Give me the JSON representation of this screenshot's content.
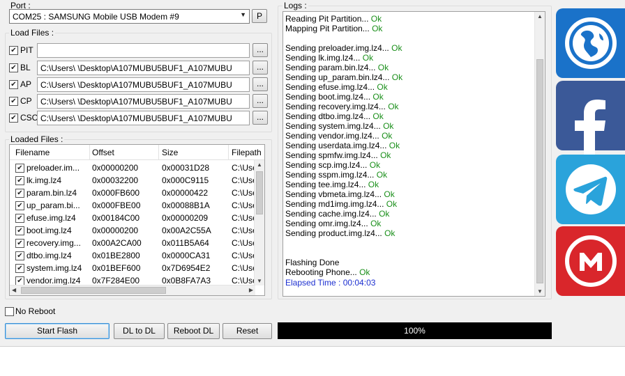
{
  "port": {
    "label": "Port :",
    "selected": "COM25 : SAMSUNG Mobile USB Modem #9",
    "p_button": "P"
  },
  "load_files": {
    "label": "Load Files :",
    "rows": [
      {
        "label": "PIT",
        "checked": true,
        "path": "",
        "browse": "..."
      },
      {
        "label": "BL",
        "checked": true,
        "path": "C:\\Users\\            \\Desktop\\A107MUBU5BUF1_A107MUBU",
        "browse": "..."
      },
      {
        "label": "AP",
        "checked": true,
        "path": "C:\\Users\\            \\Desktop\\A107MUBU5BUF1_A107MUBU",
        "browse": "..."
      },
      {
        "label": "CP",
        "checked": true,
        "path": "C:\\Users\\            \\Desktop\\A107MUBU5BUF1_A107MUBU",
        "browse": "..."
      },
      {
        "label": "CSC",
        "checked": true,
        "path": "C:\\Users\\            \\Desktop\\A107MUBU5BUF1_A107MUBU",
        "browse": "..."
      }
    ]
  },
  "loaded_files": {
    "label": "Loaded Files :",
    "columns": [
      "Filename",
      "Offset",
      "Size",
      "Filepath"
    ],
    "rows": [
      {
        "name": "preloader.im...",
        "offset": "0x00000200",
        "size": "0x00031D28",
        "path": "C:\\Use"
      },
      {
        "name": "lk.img.lz4",
        "offset": "0x00032200",
        "size": "0x000C9115",
        "path": "C:\\Use"
      },
      {
        "name": "param.bin.lz4",
        "offset": "0x000FB600",
        "size": "0x00000422",
        "path": "C:\\Use"
      },
      {
        "name": "up_param.bi...",
        "offset": "0x000FBE00",
        "size": "0x00088B1A",
        "path": "C:\\Use"
      },
      {
        "name": "efuse.img.lz4",
        "offset": "0x00184C00",
        "size": "0x00000209",
        "path": "C:\\Use"
      },
      {
        "name": "boot.img.lz4",
        "offset": "0x00000200",
        "size": "0x00A2C55A",
        "path": "C:\\Use"
      },
      {
        "name": "recovery.img...",
        "offset": "0x00A2CA00",
        "size": "0x011B5A64",
        "path": "C:\\Use"
      },
      {
        "name": "dtbo.img.lz4",
        "offset": "0x01BE2800",
        "size": "0x0000CA31",
        "path": "C:\\Use"
      },
      {
        "name": "system.img.lz4",
        "offset": "0x01BEF600",
        "size": "0x7D6954E2",
        "path": "C:\\Use"
      },
      {
        "name": "vendor.img.lz4",
        "offset": "0x7F284E00",
        "size": "0x0B8FA7A3",
        "path": "C:\\Use"
      }
    ]
  },
  "logs": {
    "label": "Logs :",
    "lines": [
      {
        "text": "Reading Pit Partition...",
        "ok": "Ok"
      },
      {
        "text": "Mapping Pit Partition...",
        "ok": "Ok"
      },
      {
        "text": "",
        "ok": ""
      },
      {
        "text": "Sending preloader.img.lz4...",
        "ok": "Ok"
      },
      {
        "text": "Sending lk.img.lz4...",
        "ok": "Ok"
      },
      {
        "text": "Sending param.bin.lz4...",
        "ok": "Ok"
      },
      {
        "text": "Sending up_param.bin.lz4...",
        "ok": "Ok"
      },
      {
        "text": "Sending efuse.img.lz4...",
        "ok": "Ok"
      },
      {
        "text": "Sending boot.img.lz4...",
        "ok": "Ok"
      },
      {
        "text": "Sending recovery.img.lz4...",
        "ok": "Ok"
      },
      {
        "text": "Sending dtbo.img.lz4...",
        "ok": "Ok"
      },
      {
        "text": "Sending system.img.lz4...",
        "ok": "Ok"
      },
      {
        "text": "Sending vendor.img.lz4...",
        "ok": "Ok"
      },
      {
        "text": "Sending userdata.img.lz4...",
        "ok": "Ok"
      },
      {
        "text": "Sending spmfw.img.lz4...",
        "ok": "Ok"
      },
      {
        "text": "Sending scp.img.lz4...",
        "ok": "Ok"
      },
      {
        "text": "Sending sspm.img.lz4...",
        "ok": "Ok"
      },
      {
        "text": "Sending tee.img.lz4...",
        "ok": "Ok"
      },
      {
        "text": "Sending vbmeta.img.lz4...",
        "ok": "Ok"
      },
      {
        "text": "Sending md1img.img.lz4...",
        "ok": "Ok"
      },
      {
        "text": "Sending cache.img.lz4...",
        "ok": "Ok"
      },
      {
        "text": "Sending omr.img.lz4...",
        "ok": "Ok"
      },
      {
        "text": "Sending product.img.lz4...",
        "ok": "Ok"
      },
      {
        "text": "",
        "ok": ""
      },
      {
        "text": "",
        "ok": ""
      },
      {
        "text": "Flashing Done",
        "ok": ""
      },
      {
        "text": "Rebooting Phone...",
        "ok": "Ok"
      },
      {
        "text": "",
        "ok": ""
      }
    ],
    "elapsed": "Elapsed Time : 00:04:03"
  },
  "options": {
    "no_reboot_label": "No Reboot",
    "no_reboot_checked": false
  },
  "buttons": {
    "start_flash": "Start Flash",
    "dl_to_dl": "DL to DL",
    "reboot_dl": "Reboot DL",
    "reset": "Reset"
  },
  "progress": {
    "value": 1.0,
    "label": "100%"
  },
  "social": [
    {
      "name": "website",
      "icon": "globe-icon",
      "color": "#1a72c9"
    },
    {
      "name": "facebook",
      "icon": "facebook-icon",
      "color": "#3b5998"
    },
    {
      "name": "telegram",
      "icon": "telegram-icon",
      "color": "#2aa3db"
    },
    {
      "name": "mega",
      "icon": "mega-icon",
      "color": "#d9262b"
    }
  ]
}
